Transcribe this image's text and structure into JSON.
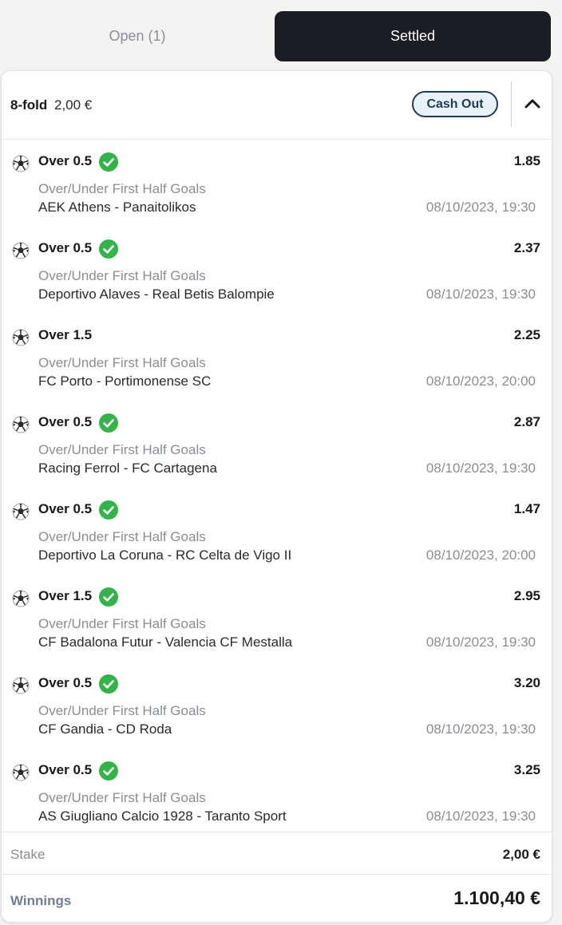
{
  "tabs": {
    "open": "Open (1)",
    "settled": "Settled"
  },
  "bet": {
    "type": "8-fold",
    "stake": "2,00 €",
    "cashout_label": "Cash Out",
    "legs": [
      {
        "selection": "Over 0.5",
        "won": true,
        "odds": "1.85",
        "market": "Over/Under First Half Goals",
        "match": "AEK Athens - Panaitolikos",
        "date": "08/10/2023, 19:30"
      },
      {
        "selection": "Over 0.5",
        "won": true,
        "odds": "2.37",
        "market": "Over/Under First Half Goals",
        "match": "Deportivo Alaves - Real Betis Balompie",
        "date": "08/10/2023, 19:30"
      },
      {
        "selection": "Over 1.5",
        "won": false,
        "odds": "2.25",
        "market": "Over/Under First Half Goals",
        "match": "FC Porto - Portimonense SC",
        "date": "08/10/2023, 20:00"
      },
      {
        "selection": "Over 0.5",
        "won": true,
        "odds": "2.87",
        "market": "Over/Under First Half Goals",
        "match": "Racing Ferrol - FC Cartagena",
        "date": "08/10/2023, 19:30"
      },
      {
        "selection": "Over 0.5",
        "won": true,
        "odds": "1.47",
        "market": "Over/Under First Half Goals",
        "match": "Deportivo La Coruna - RC Celta de Vigo II",
        "date": "08/10/2023, 20:00"
      },
      {
        "selection": "Over 1.5",
        "won": true,
        "odds": "2.95",
        "market": "Over/Under First Half Goals",
        "match": "CF Badalona Futur - Valencia CF Mestalla",
        "date": "08/10/2023, 19:30"
      },
      {
        "selection": "Over 0.5",
        "won": true,
        "odds": "3.20",
        "market": "Over/Under First Half Goals",
        "match": "CF Gandia - CD Roda",
        "date": "08/10/2023, 19:30"
      },
      {
        "selection": "Over 0.5",
        "won": true,
        "odds": "3.25",
        "market": "Over/Under First Half Goals",
        "match": "AS Giugliano Calcio 1928 - Taranto Sport",
        "date": "08/10/2023, 19:30"
      }
    ]
  },
  "summary": {
    "stake_label": "Stake",
    "stake_value": "2,00 €",
    "winnings_label": "Winnings",
    "winnings_value": "1.100,40 €"
  },
  "icons": {
    "sport": "soccer-ball-icon",
    "status": "check-circle-icon",
    "collapse": "chevron-up-icon"
  },
  "colors": {
    "check": "#34b34a",
    "cashout_border": "#1f3a52",
    "cashout_bg": "#e9f2f8",
    "active_tab": "#1c1d22"
  }
}
